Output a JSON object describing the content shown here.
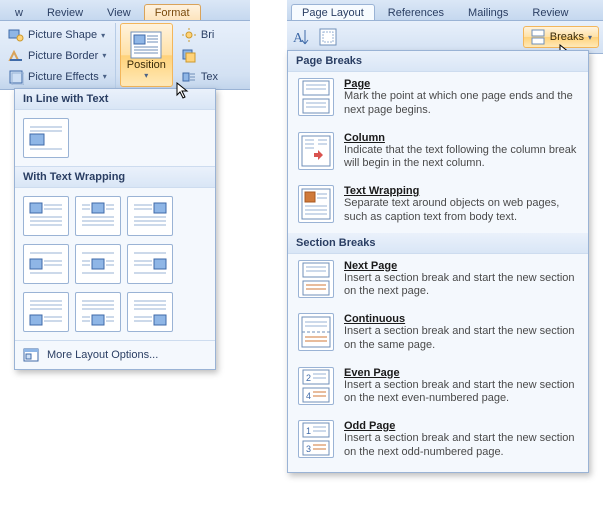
{
  "left": {
    "tabs": {
      "w": "w",
      "review": "Review",
      "view": "View",
      "format": "Format"
    },
    "picture": {
      "shape": "Picture Shape",
      "border": "Picture Border",
      "effects": "Picture Effects"
    },
    "position": "Position",
    "misc": {
      "bri": "Bri",
      "tex": "Tex"
    },
    "drop": {
      "inline": "In Line with Text",
      "wrap": "With Text Wrapping",
      "more": "More Layout Options..."
    }
  },
  "right": {
    "tabs": {
      "pagelayout": "Page Layout",
      "references": "References",
      "mailings": "Mailings",
      "review": "Review"
    },
    "breaks": "Breaks",
    "drop": {
      "pb_hdr": "Page Breaks",
      "sb_hdr": "Section Breaks",
      "page": {
        "t": "Page",
        "d": "Mark the point at which one page ends and the next page begins."
      },
      "column": {
        "t": "Column",
        "d": "Indicate that the text following the column break will begin in the next column."
      },
      "tw": {
        "t": "Text Wrapping",
        "d": "Separate text around objects on web pages, such as caption text from body text."
      },
      "nextpage": {
        "t": "Next Page",
        "d": "Insert a section break and start the new section on the next page."
      },
      "cont": {
        "t": "Continuous",
        "d": "Insert a section break and start the new section on the same page."
      },
      "even": {
        "t": "Even Page",
        "d": "Insert a section break and start the new section on the next even-numbered page."
      },
      "odd": {
        "t": "Odd Page",
        "d": "Insert a section break and start the new section on the next odd-numbered page."
      }
    }
  }
}
